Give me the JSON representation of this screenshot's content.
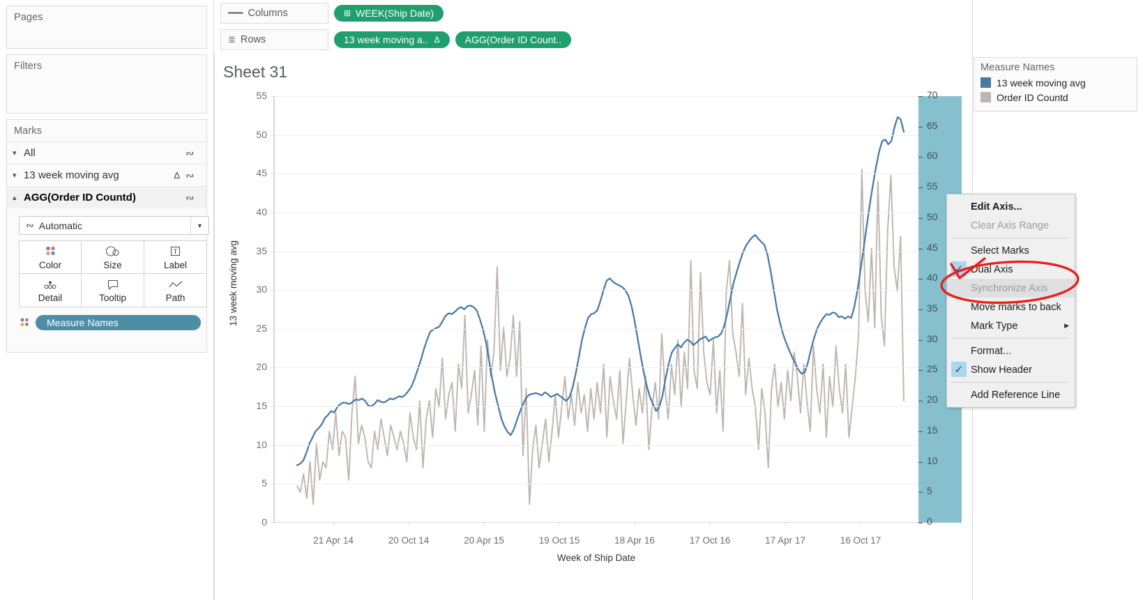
{
  "left_panel": {
    "pages": {
      "title": "Pages"
    },
    "filters": {
      "title": "Filters"
    },
    "marks": {
      "title": "Marks",
      "rows": [
        {
          "label": "All",
          "chevron": "chevron-down",
          "delta": "",
          "type_icon": "line"
        },
        {
          "label": "13 week moving avg",
          "chevron": "chevron-down",
          "delta": "Δ",
          "type_icon": "line"
        },
        {
          "label": "AGG(Order ID Countd)",
          "chevron": "chevron-up",
          "delta": "",
          "type_icon": "line"
        }
      ],
      "mark_type": "Automatic",
      "buttons": [
        {
          "label": "Color",
          "icon": "color-dots-icon"
        },
        {
          "label": "Size",
          "icon": "size-icon"
        },
        {
          "label": "Label",
          "icon": "label-icon"
        },
        {
          "label": "Detail",
          "icon": "detail-icon"
        },
        {
          "label": "Tooltip",
          "icon": "tooltip-icon"
        },
        {
          "label": "Path",
          "icon": "path-icon"
        }
      ],
      "color_pill": "Measure Names"
    }
  },
  "shelves": {
    "columns": {
      "label": "Columns",
      "pills": [
        {
          "text": "WEEK(Ship Date)",
          "prefix": "⊞"
        }
      ]
    },
    "rows": {
      "label": "Rows",
      "pills": [
        {
          "text": "13 week moving a..",
          "suffix": "Δ"
        },
        {
          "text": "AGG(Order ID Count.."
        }
      ]
    }
  },
  "viz": {
    "sheet_title": "Sheet 31"
  },
  "legend": {
    "title": "Measure Names",
    "items": [
      {
        "label": "13 week moving avg",
        "color": "#4a7aa7"
      },
      {
        "label": "Order ID Countd",
        "color": "#bdb5ae"
      }
    ]
  },
  "context_menu": {
    "items": [
      {
        "label": "Edit Axis...",
        "bold": true,
        "checked": false,
        "disabled": false,
        "submenu": false
      },
      {
        "label": "Clear Axis Range",
        "bold": false,
        "checked": false,
        "disabled": true,
        "submenu": false
      },
      {
        "separator": true
      },
      {
        "label": "Select Marks",
        "bold": false,
        "checked": false,
        "disabled": false,
        "submenu": false
      },
      {
        "label": "Dual Axis",
        "bold": false,
        "checked": true,
        "disabled": false,
        "submenu": false
      },
      {
        "label": "Synchronize Axis",
        "bold": false,
        "checked": false,
        "disabled": true,
        "highlight": true,
        "submenu": false
      },
      {
        "label": "Move marks to back",
        "bold": false,
        "checked": false,
        "disabled": false,
        "submenu": false
      },
      {
        "label": "Mark Type",
        "bold": false,
        "checked": false,
        "disabled": false,
        "submenu": true
      },
      {
        "separator": true
      },
      {
        "label": "Format...",
        "bold": false,
        "checked": false,
        "disabled": false,
        "submenu": false
      },
      {
        "label": "Show Header",
        "bold": false,
        "checked": true,
        "disabled": false,
        "submenu": false
      },
      {
        "separator": true
      },
      {
        "label": "Add Reference Line",
        "bold": false,
        "checked": false,
        "disabled": false,
        "submenu": false
      }
    ]
  },
  "annotation": {
    "shape": "red-ellipse-highlight",
    "color": "#e8201c"
  },
  "chart_data": {
    "type": "line",
    "title": "Sheet 31",
    "xlabel": "Week of Ship Date",
    "ylabel": "13 week moving avg",
    "y2label": "Order ID Countd",
    "grid": true,
    "legend_position": "right",
    "ylim": [
      0,
      55
    ],
    "y2lim": [
      0,
      70
    ],
    "yticks": [
      0,
      5,
      10,
      15,
      20,
      25,
      30,
      35,
      40,
      45,
      50,
      55
    ],
    "y2ticks": [
      0,
      5,
      10,
      15,
      20,
      25,
      30,
      35,
      40,
      45,
      50,
      55,
      60,
      65,
      70
    ],
    "xtick_labels": [
      "21 Apr 14",
      "20 Oct 14",
      "20 Apr 15",
      "19 Oct 15",
      "18 Apr 16",
      "17 Oct 16",
      "17 Apr 17",
      "16 Oct 17"
    ],
    "series": [
      {
        "name": "13 week moving avg",
        "color": "#4a7aa7",
        "axis": "left",
        "values": [
          7.4,
          7.6,
          8.0,
          9.0,
          10.2,
          11.0,
          11.8,
          12.2,
          12.7,
          13.5,
          13.9,
          14.4,
          14.2,
          14.9,
          15.3,
          15.5,
          15.4,
          15.3,
          15.6,
          15.9,
          15.8,
          16.0,
          15.7,
          15.1,
          15.0,
          15.3,
          15.8,
          15.6,
          15.5,
          15.7,
          16.0,
          15.9,
          16.1,
          16.3,
          16.2,
          16.5,
          17.0,
          17.6,
          18.6,
          19.8,
          21.0,
          22.4,
          23.6,
          24.6,
          24.9,
          25.1,
          25.3,
          26.0,
          26.7,
          27.0,
          26.9,
          27.2,
          27.6,
          27.8,
          27.5,
          27.9,
          28.0,
          27.8,
          27.4,
          26.3,
          25.0,
          23.3,
          21.0,
          18.6,
          16.6,
          15.0,
          13.4,
          12.4,
          11.7,
          11.3,
          12.0,
          13.2,
          14.3,
          15.3,
          16.1,
          16.5,
          16.6,
          16.7,
          16.6,
          16.4,
          16.8,
          16.6,
          16.2,
          16.4,
          16.6,
          16.3,
          16.0,
          15.7,
          16.2,
          17.4,
          19.2,
          21.3,
          23.5,
          25.1,
          26.4,
          26.9,
          27.0,
          27.4,
          28.6,
          30.0,
          31.2,
          31.5,
          31.1,
          30.8,
          30.6,
          30.4,
          30.0,
          29.3,
          28.0,
          26.1,
          23.8,
          21.5,
          19.4,
          17.6,
          16.2,
          15.3,
          14.4,
          14.9,
          16.3,
          18.5,
          20.4,
          21.9,
          22.5,
          23.0,
          22.6,
          23.2,
          23.6,
          23.4,
          22.9,
          23.2,
          23.6,
          23.8,
          24.0,
          23.4,
          23.7,
          23.9,
          24.0,
          24.4,
          25.4,
          27.0,
          29.0,
          30.9,
          32.3,
          33.6,
          34.8,
          35.7,
          36.3,
          36.8,
          37.1,
          36.6,
          36.2,
          35.8,
          34.5,
          32.4,
          30.0,
          27.6,
          25.8,
          24.3,
          23.2,
          22.2,
          21.3,
          20.5,
          19.7,
          19.2,
          19.4,
          20.6,
          22.3,
          23.8,
          25.0,
          25.8,
          26.4,
          26.9,
          26.8,
          27.1,
          27.0,
          26.5,
          26.6,
          26.3,
          26.6,
          26.4,
          27.8,
          29.9,
          32.5,
          35.3,
          38.2,
          41.0,
          43.5,
          45.8,
          47.8,
          49.2,
          49.4,
          48.8,
          49.2,
          51.0,
          52.3,
          52.0,
          50.4
        ]
      },
      {
        "name": "Order ID Countd",
        "color": "#bdb5ae",
        "axis": "right",
        "values": [
          6,
          5,
          8,
          4,
          10,
          3,
          13,
          7,
          10,
          9,
          15,
          12,
          18,
          11,
          15,
          14,
          7,
          18,
          24,
          13,
          16,
          14,
          10,
          9,
          15,
          12,
          17,
          14,
          11,
          16,
          14,
          12,
          15,
          13,
          10,
          18,
          14,
          12,
          20,
          9,
          17,
          20,
          14,
          22,
          19,
          27,
          17,
          21,
          23,
          15,
          26,
          22,
          34,
          18,
          21,
          25,
          16,
          29,
          15,
          30,
          24,
          28,
          42,
          25,
          32,
          24,
          27,
          34,
          24,
          33,
          11,
          22,
          3,
          12,
          16,
          9,
          13,
          17,
          10,
          15,
          21,
          14,
          19,
          24,
          17,
          21,
          16,
          23,
          18,
          21,
          15,
          22,
          17,
          23,
          18,
          26,
          14,
          24,
          20,
          17,
          25,
          13,
          20,
          27,
          21,
          16,
          22,
          18,
          24,
          12,
          19,
          23,
          17,
          31,
          22,
          17,
          26,
          21,
          30,
          19,
          28,
          22,
          43,
          25,
          22,
          41,
          28,
          23,
          21,
          30,
          18,
          25,
          15,
          38,
          43,
          31,
          28,
          24,
          36,
          21,
          27,
          22,
          19,
          12,
          22,
          18,
          9,
          22,
          26,
          19,
          23,
          17,
          25,
          20,
          28,
          24,
          18,
          26,
          20,
          15,
          29,
          22,
          18,
          26,
          14,
          24,
          19,
          29,
          22,
          18,
          26,
          14,
          19,
          24,
          31,
          58,
          38,
          33,
          45,
          32,
          56,
          34,
          29,
          48,
          57,
          42,
          38,
          47,
          20
        ]
      }
    ]
  }
}
